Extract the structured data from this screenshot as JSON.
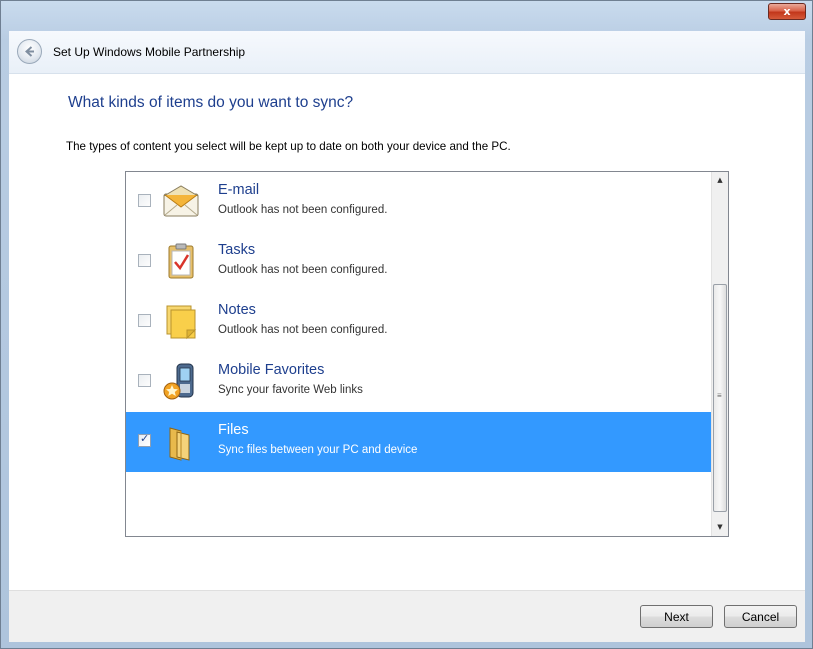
{
  "window": {
    "close_label": "x",
    "title": "Set Up Windows Mobile Partnership"
  },
  "page": {
    "heading": "What kinds of items do you want to sync?",
    "subtitle": "The types of content you select will be kept up to date on both your device and the PC."
  },
  "items": [
    {
      "title": "E-mail",
      "subtitle": "Outlook has not been configured.",
      "checked": false,
      "selected": false,
      "icon": "email-icon"
    },
    {
      "title": "Tasks",
      "subtitle": "Outlook has not been configured.",
      "checked": false,
      "selected": false,
      "icon": "tasks-icon"
    },
    {
      "title": "Notes",
      "subtitle": "Outlook has not been configured.",
      "checked": false,
      "selected": false,
      "icon": "notes-icon"
    },
    {
      "title": "Mobile Favorites",
      "subtitle": "Sync your favorite Web links",
      "checked": false,
      "selected": false,
      "icon": "mobile-favorites-icon"
    },
    {
      "title": "Files",
      "subtitle": "Sync files between your PC and device",
      "checked": true,
      "selected": true,
      "icon": "folder-icon"
    }
  ],
  "buttons": {
    "next": "Next",
    "cancel": "Cancel"
  },
  "colors": {
    "selection": "#3399ff",
    "heading": "#1e3f8e"
  }
}
